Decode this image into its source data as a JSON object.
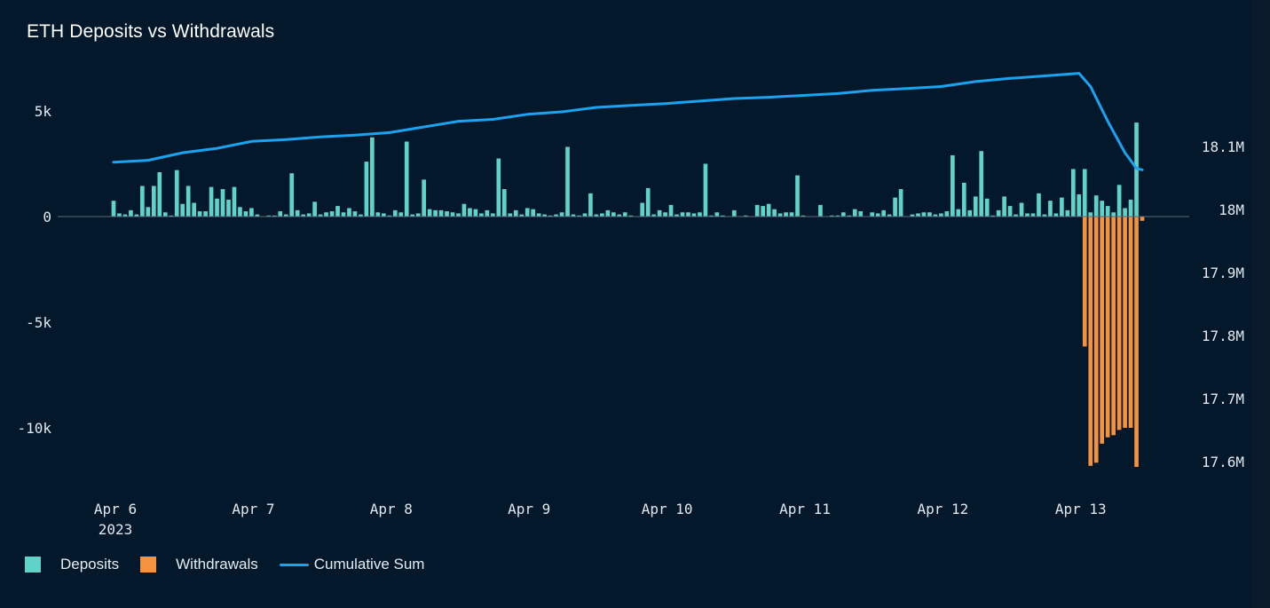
{
  "title": "ETH Deposits vs Withdrawals",
  "colors": {
    "deposits": "#5fd3c9",
    "withdrawals": "#f5923e",
    "cumulative": "#1aa3f0"
  },
  "legend": [
    {
      "label": "Deposits",
      "kind": "swatch",
      "color": "#5fd3c9"
    },
    {
      "label": "Withdrawals",
      "kind": "swatch",
      "color": "#f5923e"
    },
    {
      "label": "Cumulative Sum",
      "kind": "line",
      "color": "#1aa3f0"
    }
  ],
  "chart_data": {
    "type": "bar",
    "title": "ETH Deposits vs Withdrawals",
    "xlabel": "",
    "ylabel": "",
    "y_left": {
      "ticks": [
        "5k",
        "0",
        "-5k",
        "-10k"
      ],
      "tick_values": [
        5000,
        0,
        -5000,
        -10000
      ],
      "range": [
        -12500,
        5000
      ]
    },
    "y_right": {
      "ticks": [
        "18.1M",
        "18M",
        "17.9M",
        "17.8M",
        "17.7M",
        "17.6M"
      ],
      "tick_values": [
        18100000,
        18000000,
        17900000,
        17800000,
        17700000,
        17600000
      ],
      "range": [
        17580000,
        18180000
      ]
    },
    "x_ticks": [
      {
        "label": "Apr 6",
        "sub": "2023",
        "date": "2023-04-06"
      },
      {
        "label": "Apr 7",
        "sub": "",
        "date": "2023-04-07"
      },
      {
        "label": "Apr 8",
        "sub": "",
        "date": "2023-04-08"
      },
      {
        "label": "Apr 9",
        "sub": "",
        "date": "2023-04-09"
      },
      {
        "label": "Apr 10",
        "sub": "",
        "date": "2023-04-10"
      },
      {
        "label": "Apr 11",
        "sub": "",
        "date": "2023-04-11"
      },
      {
        "label": "Apr 12",
        "sub": "",
        "date": "2023-04-12"
      },
      {
        "label": "Apr 13",
        "sub": "",
        "date": "2023-04-13"
      }
    ],
    "legend_position": "bottom-left",
    "grid": false,
    "series": [
      {
        "name": "Deposits",
        "axis": "left",
        "start": "2023-04-06 00:00",
        "interval_hours": 1,
        "values": [
          750,
          150,
          100,
          300,
          100,
          1450,
          450,
          1450,
          2100,
          200,
          50,
          2200,
          600,
          1450,
          650,
          250,
          250,
          1400,
          850,
          1300,
          800,
          1400,
          450,
          250,
          400,
          100,
          0,
          50,
          50,
          250,
          100,
          2050,
          300,
          100,
          150,
          700,
          100,
          200,
          250,
          500,
          200,
          400,
          250,
          100,
          2600,
          3750,
          200,
          150,
          50,
          300,
          200,
          3550,
          100,
          150,
          1750,
          350,
          300,
          300,
          250,
          200,
          150,
          600,
          400,
          350,
          150,
          300,
          150,
          2750,
          1300,
          150,
          300,
          100,
          400,
          350,
          150,
          100,
          50,
          100,
          200,
          3300,
          100,
          50,
          150,
          1100,
          100,
          150,
          300,
          200,
          100,
          200,
          50,
          0,
          650,
          1350,
          100,
          300,
          200,
          550,
          100,
          200,
          200,
          150,
          200,
          2500,
          50,
          200,
          50,
          0,
          300,
          0,
          50,
          0,
          550,
          500,
          600,
          350,
          150,
          200,
          200,
          1950,
          50,
          0,
          0,
          550,
          0,
          50,
          50,
          200,
          50,
          350,
          250,
          0,
          200,
          150,
          300,
          100,
          900,
          1300,
          0,
          100,
          150,
          200,
          200,
          100,
          150,
          250,
          2900,
          350,
          1600,
          300,
          950,
          3100,
          850,
          50,
          300,
          950,
          500,
          100,
          650,
          150,
          150,
          1100,
          100,
          750,
          150,
          900,
          300,
          2250,
          1050,
          2250,
          200,
          1000,
          750,
          500,
          200,
          1500,
          400,
          800,
          4450,
          0
        ]
      },
      {
        "name": "Withdrawals",
        "axis": "left",
        "start": "2023-04-13 01:00",
        "interval_hours": 1,
        "values": [
          -6150,
          -11800,
          -11650,
          -10750,
          -10450,
          -10350,
          -10100,
          -10000,
          -10000,
          -11850,
          -200
        ]
      },
      {
        "name": "Cumulative Sum",
        "axis": "right",
        "kind": "line",
        "points": [
          [
            "2023-04-06 00:00",
            18075000
          ],
          [
            "2023-04-06 06:00",
            18078000
          ],
          [
            "2023-04-06 12:00",
            18090000
          ],
          [
            "2023-04-06 18:00",
            18097000
          ],
          [
            "2023-04-07 00:00",
            18108000
          ],
          [
            "2023-04-07 06:00",
            18111000
          ],
          [
            "2023-04-07 12:00",
            18115000
          ],
          [
            "2023-04-07 18:00",
            18118000
          ],
          [
            "2023-04-08 00:00",
            18122000
          ],
          [
            "2023-04-08 06:00",
            18131000
          ],
          [
            "2023-04-08 12:00",
            18140000
          ],
          [
            "2023-04-08 18:00",
            18143000
          ],
          [
            "2023-04-09 00:00",
            18151000
          ],
          [
            "2023-04-09 06:00",
            18155000
          ],
          [
            "2023-04-09 12:00",
            18162000
          ],
          [
            "2023-04-09 18:00",
            18165000
          ],
          [
            "2023-04-10 00:00",
            18168000
          ],
          [
            "2023-04-10 06:00",
            18172000
          ],
          [
            "2023-04-10 12:00",
            18176000
          ],
          [
            "2023-04-10 18:00",
            18178000
          ],
          [
            "2023-04-11 00:00",
            18181000
          ],
          [
            "2023-04-11 06:00",
            18184000
          ],
          [
            "2023-04-11 12:00",
            18189000
          ],
          [
            "2023-04-11 18:00",
            18192000
          ],
          [
            "2023-04-12 00:00",
            18195000
          ],
          [
            "2023-04-12 06:00",
            18203000
          ],
          [
            "2023-04-12 12:00",
            18208000
          ],
          [
            "2023-04-12 18:00",
            18212000
          ],
          [
            "2023-04-13 00:00",
            18216000
          ],
          [
            "2023-04-13 02:00",
            18195000
          ],
          [
            "2023-04-13 05:00",
            18140000
          ],
          [
            "2023-04-13 08:00",
            18090000
          ],
          [
            "2023-04-13 10:00",
            18065000
          ],
          [
            "2023-04-13 11:00",
            18063000
          ]
        ]
      }
    ]
  }
}
